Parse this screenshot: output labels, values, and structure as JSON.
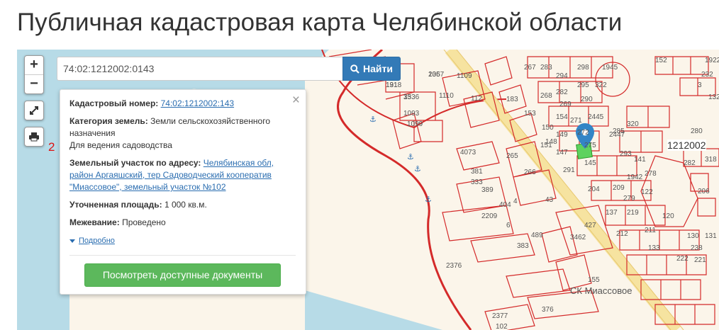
{
  "page": {
    "title": "Публичная кадастровая карта Челябинской области"
  },
  "map": {
    "zoom_in": "+",
    "zoom_out": "−",
    "search": {
      "value": "74:02:1212002:0143",
      "button_label": "Найти"
    },
    "side_number": "2",
    "labels": {
      "block": "1212002",
      "place": "СК Миассовое"
    },
    "plot_numbers": [
      "191",
      "35",
      "205",
      "1109",
      "1093",
      "1110",
      "112",
      "1099",
      "4073",
      "265",
      "381",
      "333",
      "389",
      "266",
      "4",
      "404",
      "43",
      "2209",
      "6",
      "383",
      "489",
      "427",
      "3462",
      "2376",
      "2377",
      "102",
      "376",
      "155",
      "183",
      "267",
      "283",
      "294",
      "298",
      "1945",
      "152",
      "153",
      "268",
      "282",
      "295",
      "150",
      "154",
      "269",
      "290",
      "149",
      "271",
      "2445",
      "322",
      "148",
      "272",
      "285",
      "320",
      "147",
      "151",
      "2447",
      "291",
      "275",
      "293",
      "145",
      "1942",
      "141",
      "278",
      "279",
      "280",
      "282",
      "318",
      "206",
      "204",
      "209",
      "137",
      "212",
      "211",
      "133",
      "130",
      "131",
      "238",
      "222",
      "221",
      "219",
      "120",
      "122",
      "1922",
      "232",
      "3",
      "1327",
      "1318",
      "1336",
      "1367"
    ],
    "colors": {
      "water": "#b7dbe7",
      "land": "#fbf5ea",
      "boundary": "#d42a2a",
      "road": "#f6e3a0",
      "marker": "#3385c6",
      "selected": "#5ed25e"
    },
    "icons": [
      "zoom-in-icon",
      "zoom-out-icon",
      "fullscreen-icon",
      "print-icon",
      "search-icon",
      "location-pin-icon",
      "anchor-icon"
    ]
  },
  "popup": {
    "close": "×",
    "cadastral_label": "Кадастровый номер:",
    "cadastral_value": "74:02:1212002:143",
    "category_label": "Категория земель:",
    "category_value": "Земли сельскохозяйственного назначения",
    "usage": "Для ведения садоводства",
    "address_label": "Земельный участок по адресу:",
    "address_value": "Челябинская обл, район Аргаяшский, тер Садоводческий кооператив \"Миассовое\", земельный участок №102",
    "area_label": "Уточненная площадь:",
    "area_value": "1 000 кв.м.",
    "survey_label": "Межевание:",
    "survey_value": "Проведено",
    "more_label": "Подробно",
    "docs_button": "Посмотреть доступные документы"
  }
}
